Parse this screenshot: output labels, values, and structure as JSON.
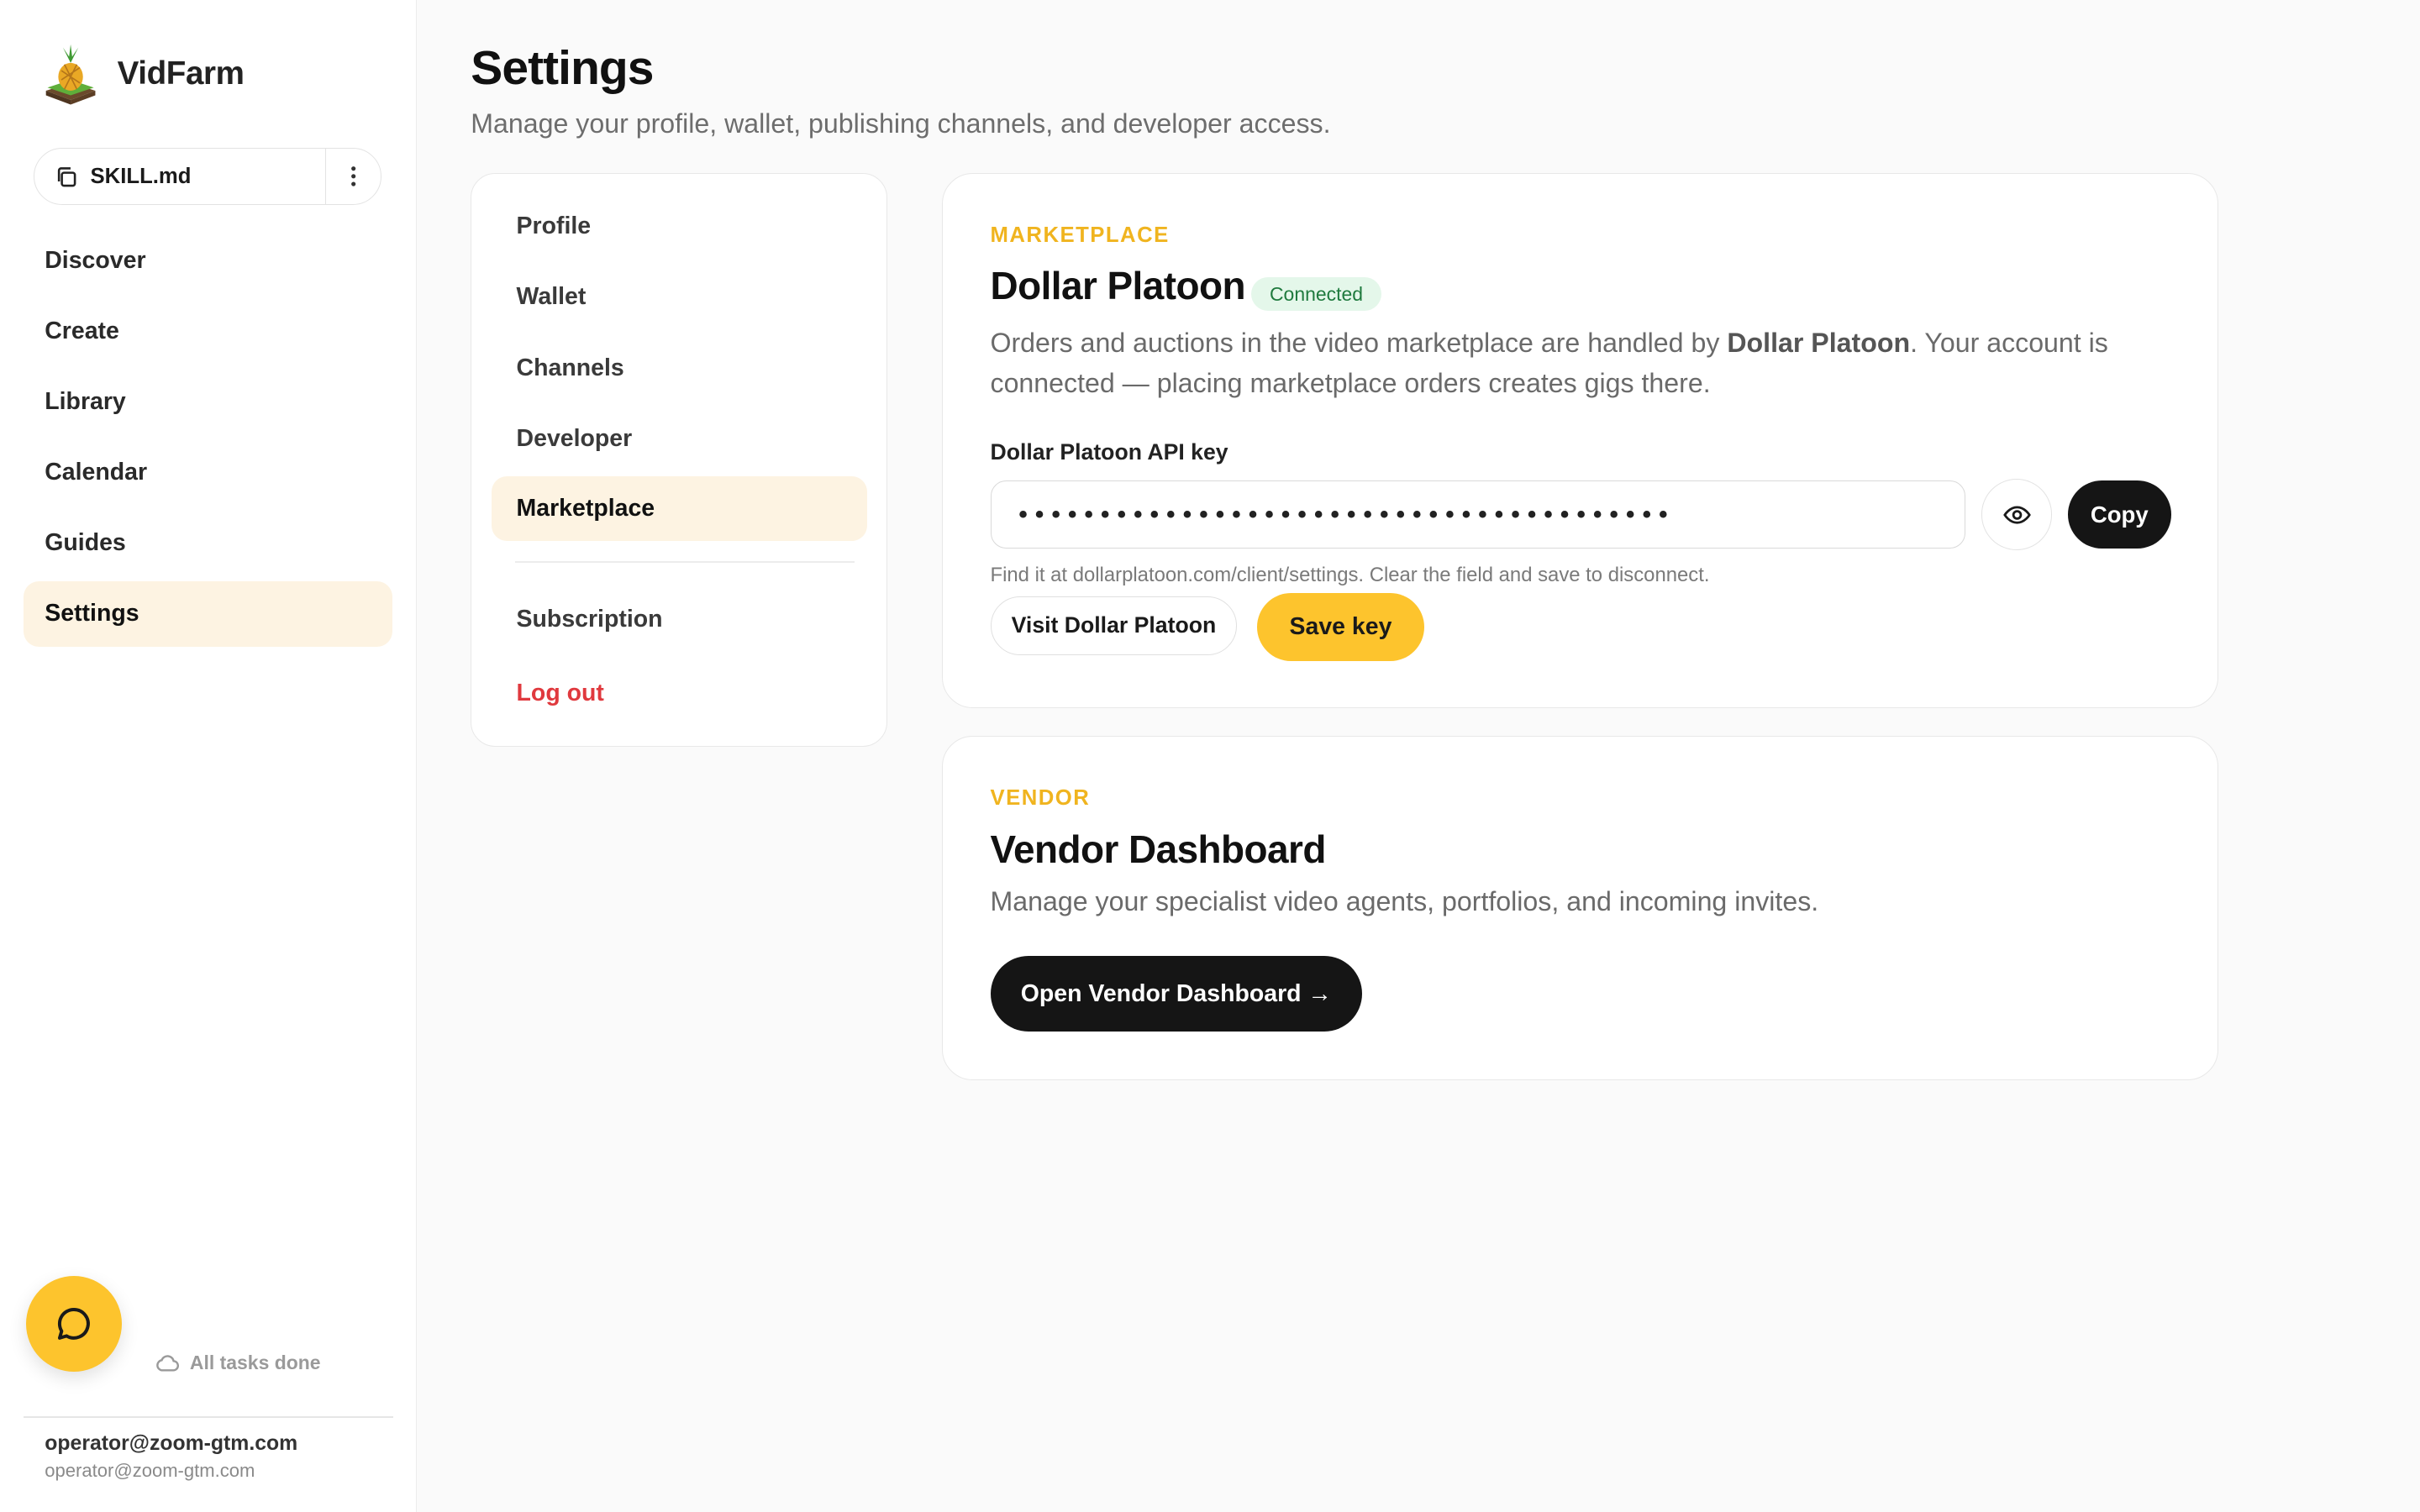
{
  "brand": {
    "name": "VidFarm",
    "logo_icon": "pineapple-farm-logo"
  },
  "skill": {
    "label": "SKILL.md",
    "copy_icon": "copy-icon",
    "more_icon": "kebab-menu-icon"
  },
  "nav": {
    "items": [
      {
        "label": "Discover"
      },
      {
        "label": "Create"
      },
      {
        "label": "Library"
      },
      {
        "label": "Calendar"
      },
      {
        "label": "Guides"
      },
      {
        "label": "Settings",
        "active": true
      }
    ]
  },
  "status": {
    "tasks": "All tasks done",
    "icon": "cloud-icon"
  },
  "user": {
    "email": "operator@zoom-gtm.com",
    "sub": "operator@zoom-gtm.com"
  },
  "page": {
    "title": "Settings",
    "subtitle": "Manage your profile, wallet, publishing channels, and developer access."
  },
  "settings_nav": {
    "items": [
      "Profile",
      "Wallet",
      "Channels",
      "Developer",
      "Marketplace"
    ],
    "active": "Marketplace",
    "subscription": "Subscription",
    "logout": "Log out"
  },
  "marketplace": {
    "eyebrow": "MARKETPLACE",
    "title": "Dollar Platoon",
    "badge": "Connected",
    "desc_pre": "Orders and auctions in the video marketplace are handled by ",
    "desc_bold": "Dollar Platoon",
    "desc_post": ". Your account is connected — placing marketplace orders creates gigs there.",
    "field_label": "Dollar Platoon API key",
    "key_masked": "••••••••••••••••••••••••••••••••••••••••",
    "hint": "Find it at dollarplatoon.com/client/settings. Clear the field and save to disconnect.",
    "copy_label": "Copy",
    "visit_label": "Visit Dollar Platoon",
    "save_label": "Save key"
  },
  "vendor": {
    "eyebrow": "VENDOR",
    "title": "Vendor Dashboard",
    "desc": "Manage your specialist video agents, portfolios, and incoming invites.",
    "button": "Open Vendor Dashboard →"
  },
  "colors": {
    "accent": "#fdc42d",
    "active_bg": "#fdf3e2",
    "eyebrow": "#f0b41f",
    "danger": "#e0393e",
    "success_bg": "#e4f7ea",
    "success_text": "#1f7a3e",
    "dark": "#151515"
  }
}
